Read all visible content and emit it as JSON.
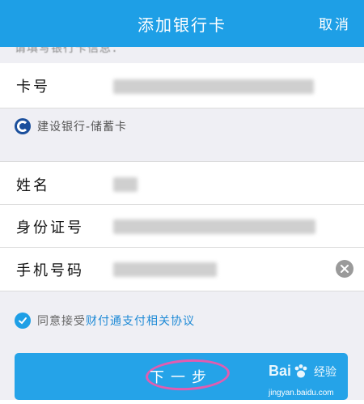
{
  "header": {
    "title": "添加银行卡",
    "cancel": "取消"
  },
  "hint": "请填写银行卡信息：",
  "form": {
    "card_number_label": "卡号",
    "bank_name": "建设银行-储蓄卡",
    "name_label": "姓名",
    "id_label": "身份证号",
    "phone_label": "手机号码"
  },
  "agreement": {
    "prefix": "同意接受",
    "link": "财付通支付相关协议"
  },
  "next_button": "下一步",
  "watermark": {
    "logo_left": "Bai",
    "logo_right": "经验",
    "url": "jingyan.baidu.com"
  },
  "colors": {
    "header": "#1e9fe6",
    "button": "#25a3e8",
    "link": "#1e8ad6",
    "annotation": "#e25cb0"
  }
}
